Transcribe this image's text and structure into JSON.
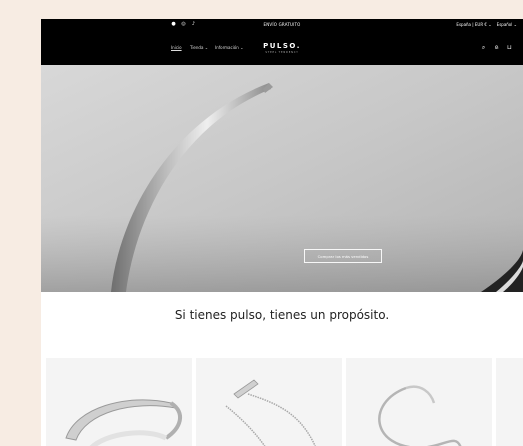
{
  "announcement": {
    "text": "ENVÍO GRATUITO",
    "region": "España | EUR €",
    "language": "Español"
  },
  "social": [
    "facebook-icon",
    "instagram-icon",
    "tiktok-icon"
  ],
  "nav": {
    "home": "Inicio",
    "shop": "Tienda",
    "info": "Información"
  },
  "logo": {
    "name": "PULSO.",
    "tagline": "STEEL TENDENCY"
  },
  "header_icons": [
    "search-icon",
    "account-icon",
    "cart-icon"
  ],
  "hero": {
    "button": "Comprar los más vendidos"
  },
  "tagline": "Si tienes pulso, tienes un propósito.",
  "products": [
    "cuff-bracelet",
    "chain-bracelet",
    "snake-necklace",
    "partial-product"
  ],
  "colors": {
    "background": "#f7ece3",
    "header": "#000000",
    "hero": "#c9c9c9"
  }
}
